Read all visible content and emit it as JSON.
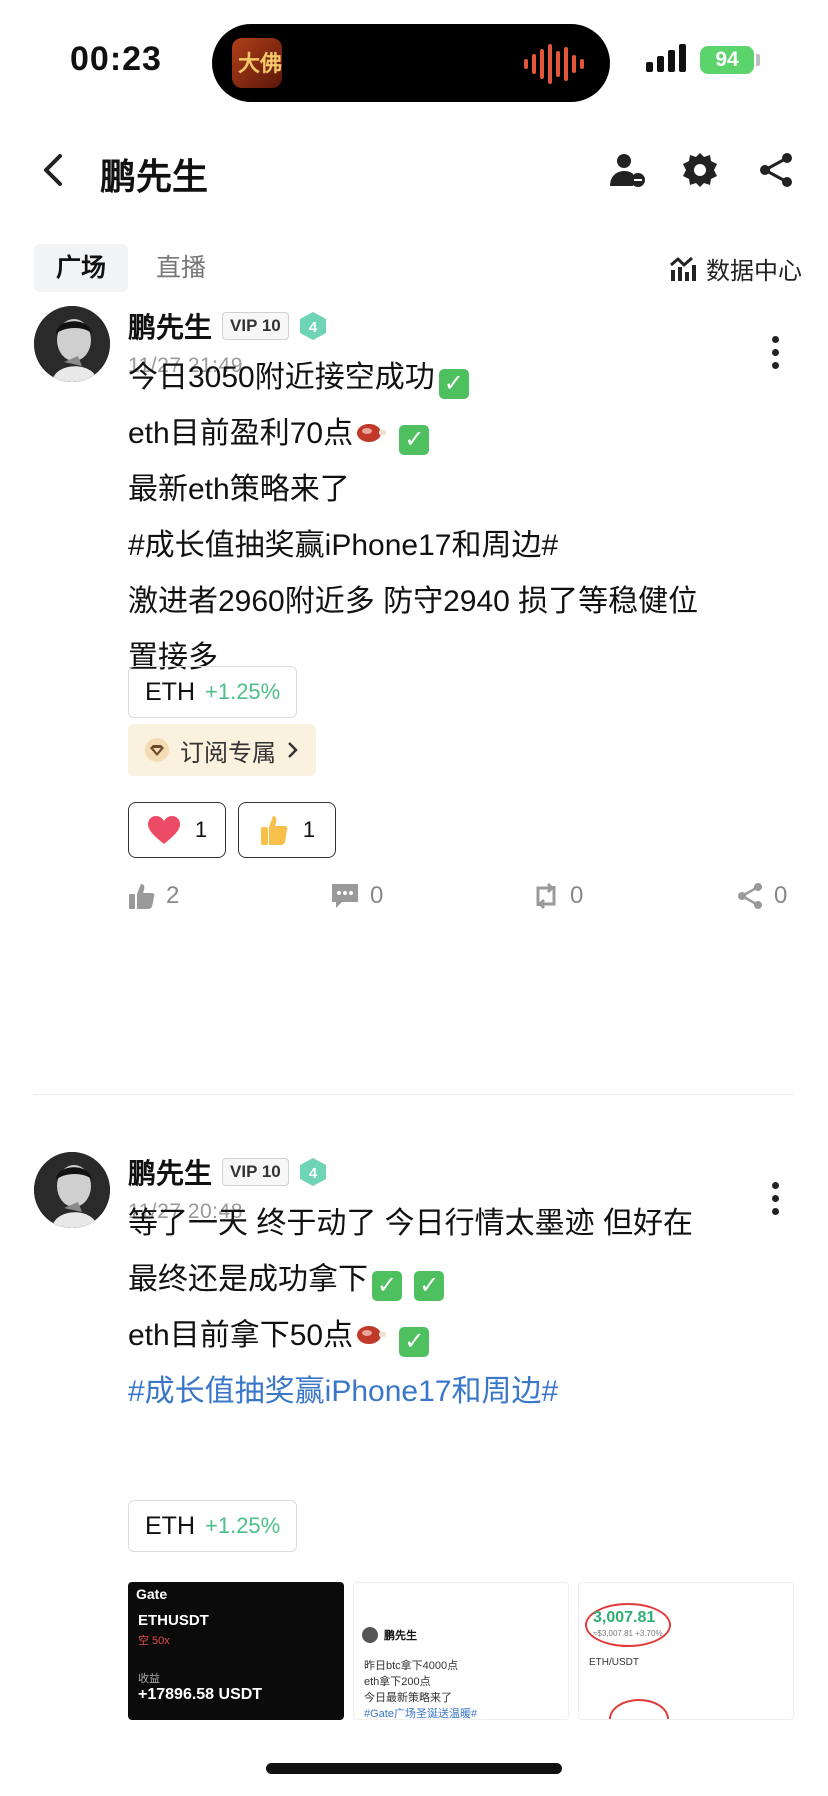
{
  "status": {
    "time": "00:23",
    "battery": "94"
  },
  "header": {
    "title": "鹏先生"
  },
  "tabs": [
    {
      "label": "广场"
    },
    {
      "label": "直播"
    }
  ],
  "data_center": {
    "label": "数据中心"
  },
  "posts": [
    {
      "author": "鹏先生",
      "vip": "VIP 10",
      "level": "4",
      "time": "11/27 21:49",
      "lines": [
        "今日3050附近接空成功",
        "eth目前盈利70点",
        "最新eth策略来了",
        "#成长值抽奖赢iPhone17和周边#",
        "激进者2960附近多 防守2940 损了等稳健位",
        "置接多"
      ],
      "ticker": {
        "symbol": "ETH",
        "change": "+1.25%"
      },
      "subscribe": {
        "label": "订阅专属"
      },
      "reactions": [
        {
          "icon": "heart-icon",
          "count": "1"
        },
        {
          "icon": "thumbs-up-emoji",
          "count": "1"
        }
      ],
      "actions": {
        "likes": "2",
        "comments": "0",
        "reposts": "0",
        "shares": "0"
      }
    },
    {
      "author": "鹏先生",
      "vip": "VIP 10",
      "level": "4",
      "time": "11/27 20:48",
      "lines": [
        "等了一天 终于动了 今日行情太墨迹 但好在",
        "最终还是成功拿下",
        "eth目前拿下50点",
        "#成长值抽奖赢iPhone17和周边#"
      ],
      "ticker": {
        "symbol": "ETH",
        "change": "+1.25%"
      },
      "thumbnails": {
        "t1": {
          "brand": "Gate",
          "pair": "ETHUSDT",
          "sub": "空 50x",
          "label": "收益",
          "pnl": "+17896.58 USDT"
        },
        "t2": {
          "name": "鹏先生",
          "l1": "昨日btc拿下4000点",
          "l2": "eth拿下200点",
          "l3": "今日最新策略来了",
          "l4": "#Gate广场圣诞送温暖#"
        },
        "t3": {
          "price": "3,007.81",
          "sub": "≈$3,007.81 +3.70%",
          "pair": "ETH/USDT"
        }
      }
    }
  ]
}
